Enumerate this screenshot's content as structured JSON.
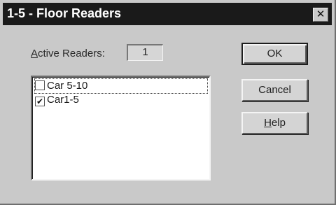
{
  "window": {
    "title": "1-5 - Floor Readers",
    "close_glyph": "✕"
  },
  "active_readers": {
    "label_accel": "A",
    "label_rest": "ctive Readers:",
    "value": "1"
  },
  "readers_list": {
    "items": [
      {
        "label": "Car 5-10",
        "checked": false,
        "focused": true,
        "check_glyph": ""
      },
      {
        "label": "Car1-5",
        "checked": true,
        "focused": false,
        "check_glyph": "✔"
      }
    ]
  },
  "buttons": {
    "ok_label": "OK",
    "cancel_label": "Cancel",
    "help_accel": "H",
    "help_rest": "elp"
  }
}
